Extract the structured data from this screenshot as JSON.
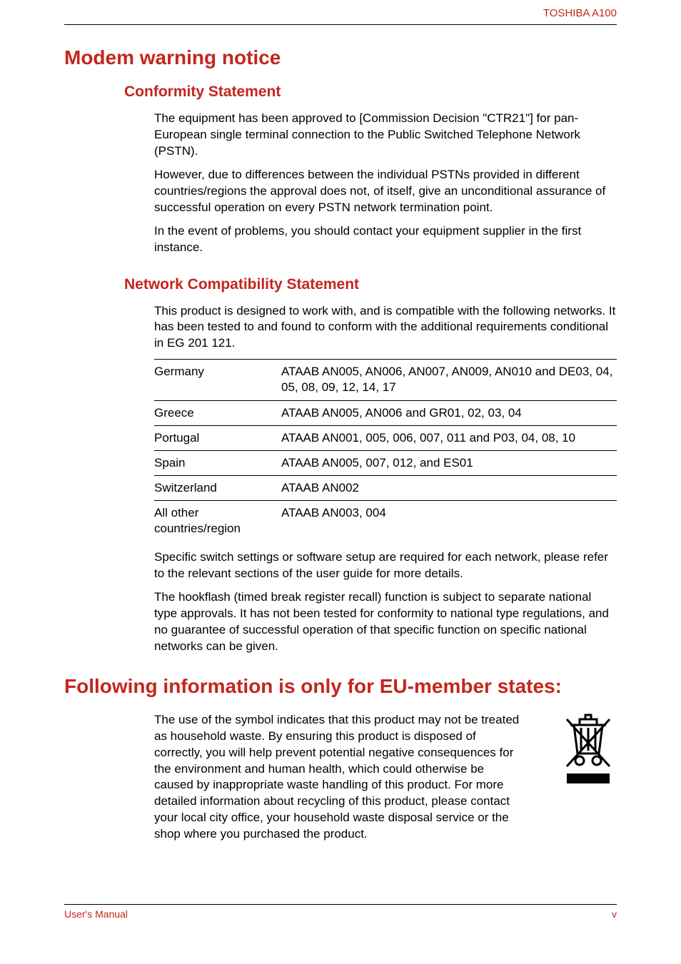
{
  "header": {
    "product": "TOSHIBA A100"
  },
  "section1": {
    "title": "Modem warning notice",
    "sub1": {
      "title": "Conformity Statement",
      "p1": "The equipment has been approved to [Commission Decision \"CTR21\"] for pan-European single terminal connection to the Public Switched Telephone Network (PSTN).",
      "p2": "However, due to differences between the individual PSTNs provided in different countries/regions the approval does not, of itself, give an unconditional assurance of successful operation on every PSTN network termination point.",
      "p3": "In the event of problems, you should contact your equipment supplier in the first instance."
    },
    "sub2": {
      "title": "Network Compatibility Statement",
      "intro": "This product is designed to work with, and is compatible with the following networks. It has been tested to and found to conform with the additional requirements conditional in EG 201 121.",
      "rows": [
        {
          "country": "Germany",
          "value": "ATAAB AN005, AN006, AN007, AN009, AN010 and DE03, 04, 05, 08, 09, 12, 14, 17"
        },
        {
          "country": "Greece",
          "value": "ATAAB AN005, AN006 and GR01, 02, 03, 04"
        },
        {
          "country": "Portugal",
          "value": "ATAAB AN001, 005, 006, 007, 011 and P03, 04, 08, 10"
        },
        {
          "country": "Spain",
          "value": "ATAAB AN005, 007, 012, and ES01"
        },
        {
          "country": "Switzerland",
          "value": "ATAAB AN002"
        },
        {
          "country": "All other countries/region",
          "value": "ATAAB AN003, 004"
        }
      ],
      "p_after1": "Specific switch settings or software setup are required for each network, please refer to the relevant sections of the user guide for more details.",
      "p_after2": "The hookflash (timed break register recall) function is subject to separate national type approvals. It has not been tested for conformity to national type regulations, and no guarantee of successful operation of that specific function on specific national networks can be given."
    }
  },
  "section2": {
    "title": "Following information is only for EU-member states:",
    "p1": "The use of the symbol indicates that this product may not be treated as household waste. By ensuring this product is disposed of correctly, you will help prevent potential negative consequences for the environment and human health, which could otherwise be caused by inappropriate waste handling of this product. For more detailed information about recycling of this product, please contact your local city office, your household waste disposal service or the shop where you purchased the product."
  },
  "footer": {
    "left": "User's Manual",
    "right": "v"
  }
}
